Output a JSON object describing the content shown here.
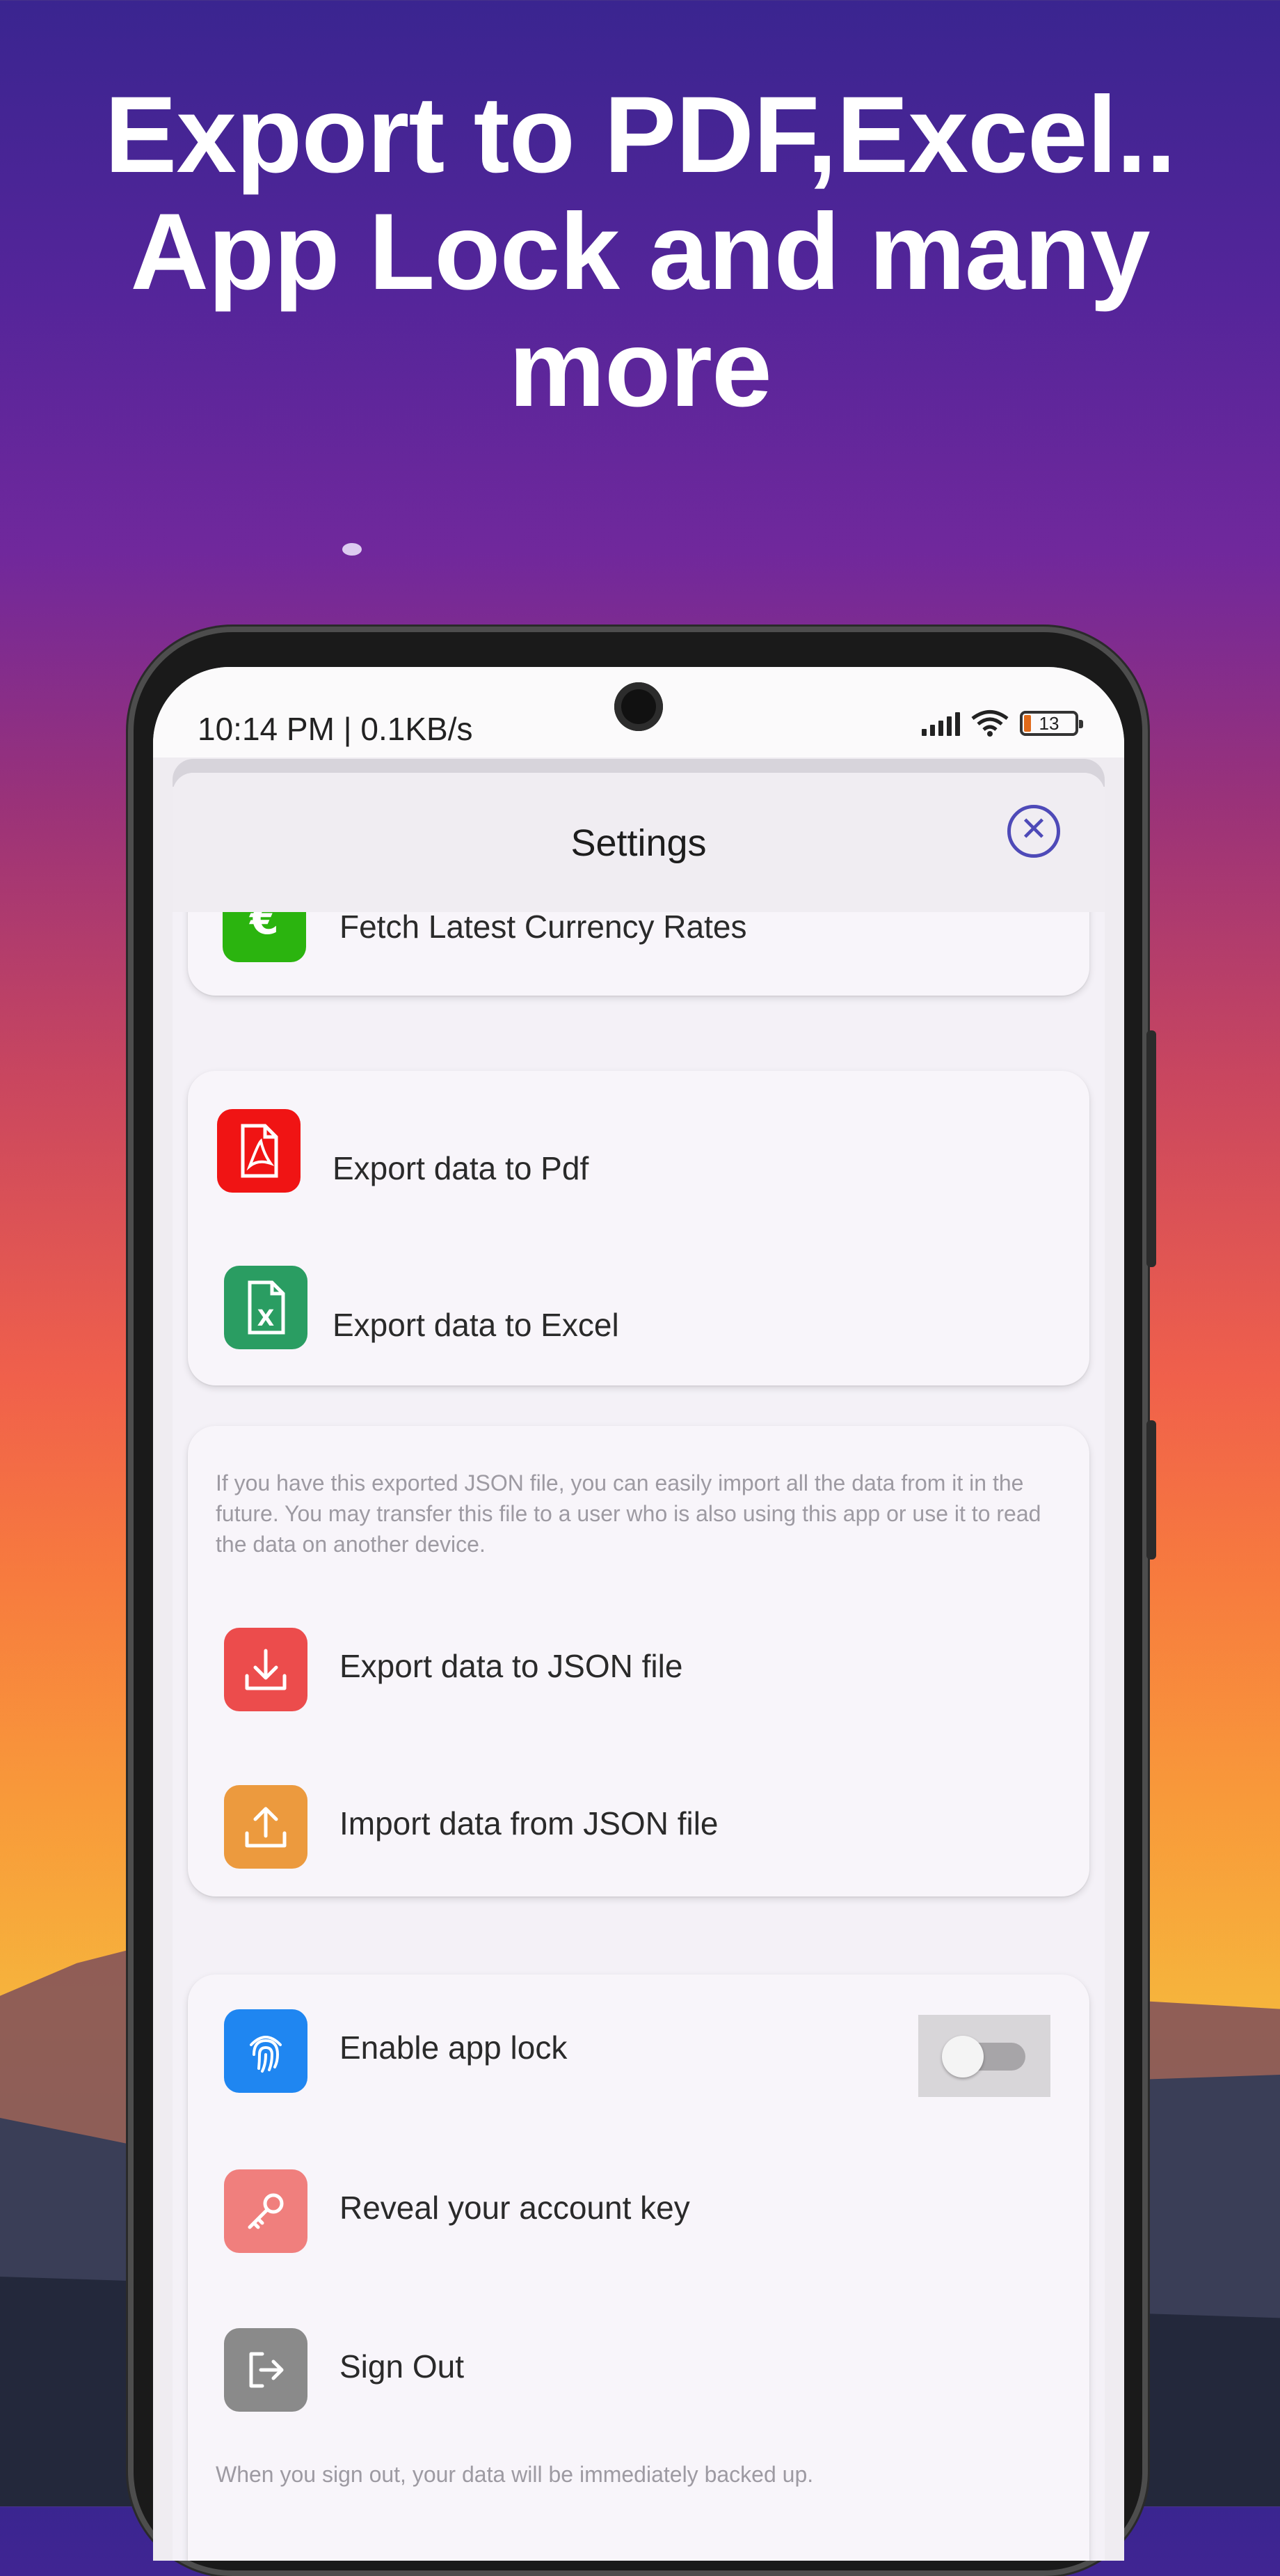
{
  "promo": {
    "headline_line1": "Export to PDF,Excel..",
    "headline_line2": "App Lock and many more"
  },
  "status_bar": {
    "time": "10:14 PM | 0.1KB/s",
    "battery": "13"
  },
  "sheet": {
    "title": "Settings",
    "close_icon": "close-icon"
  },
  "sections": {
    "currency": {
      "label": "Fetch Latest Currency Rates",
      "icon": "euro-icon",
      "icon_color": "#2bb40f"
    },
    "export": [
      {
        "label": "Export data to Pdf",
        "icon": "pdf-icon",
        "icon_color": "#f01414"
      },
      {
        "label": "Export data to Excel",
        "icon": "excel-icon",
        "icon_color": "#2a9d62"
      }
    ],
    "json": {
      "note": "If you have this exported JSON file, you can easily import all the data from it in the future. You may transfer this file to a user who is also using this app or use it to read the data on another device.",
      "items": [
        {
          "label": "Export data to JSON file",
          "icon": "download-icon",
          "icon_color": "#ec4c4c"
        },
        {
          "label": "Import data from JSON file",
          "icon": "upload-icon",
          "icon_color": "#ec9a3e"
        }
      ]
    },
    "account": {
      "app_lock": {
        "label": "Enable app lock",
        "icon": "fingerprint-icon",
        "icon_color": "#1f86f1",
        "enabled": false
      },
      "reveal_key": {
        "label": "Reveal your account key",
        "icon": "key-icon",
        "icon_color": "#f07f7d"
      },
      "sign_out": {
        "label": "Sign Out",
        "icon": "sign-out-icon",
        "icon_color": "#8a8a8a"
      },
      "footer_note": "When you sign out, your data will be immediately backed up."
    }
  }
}
